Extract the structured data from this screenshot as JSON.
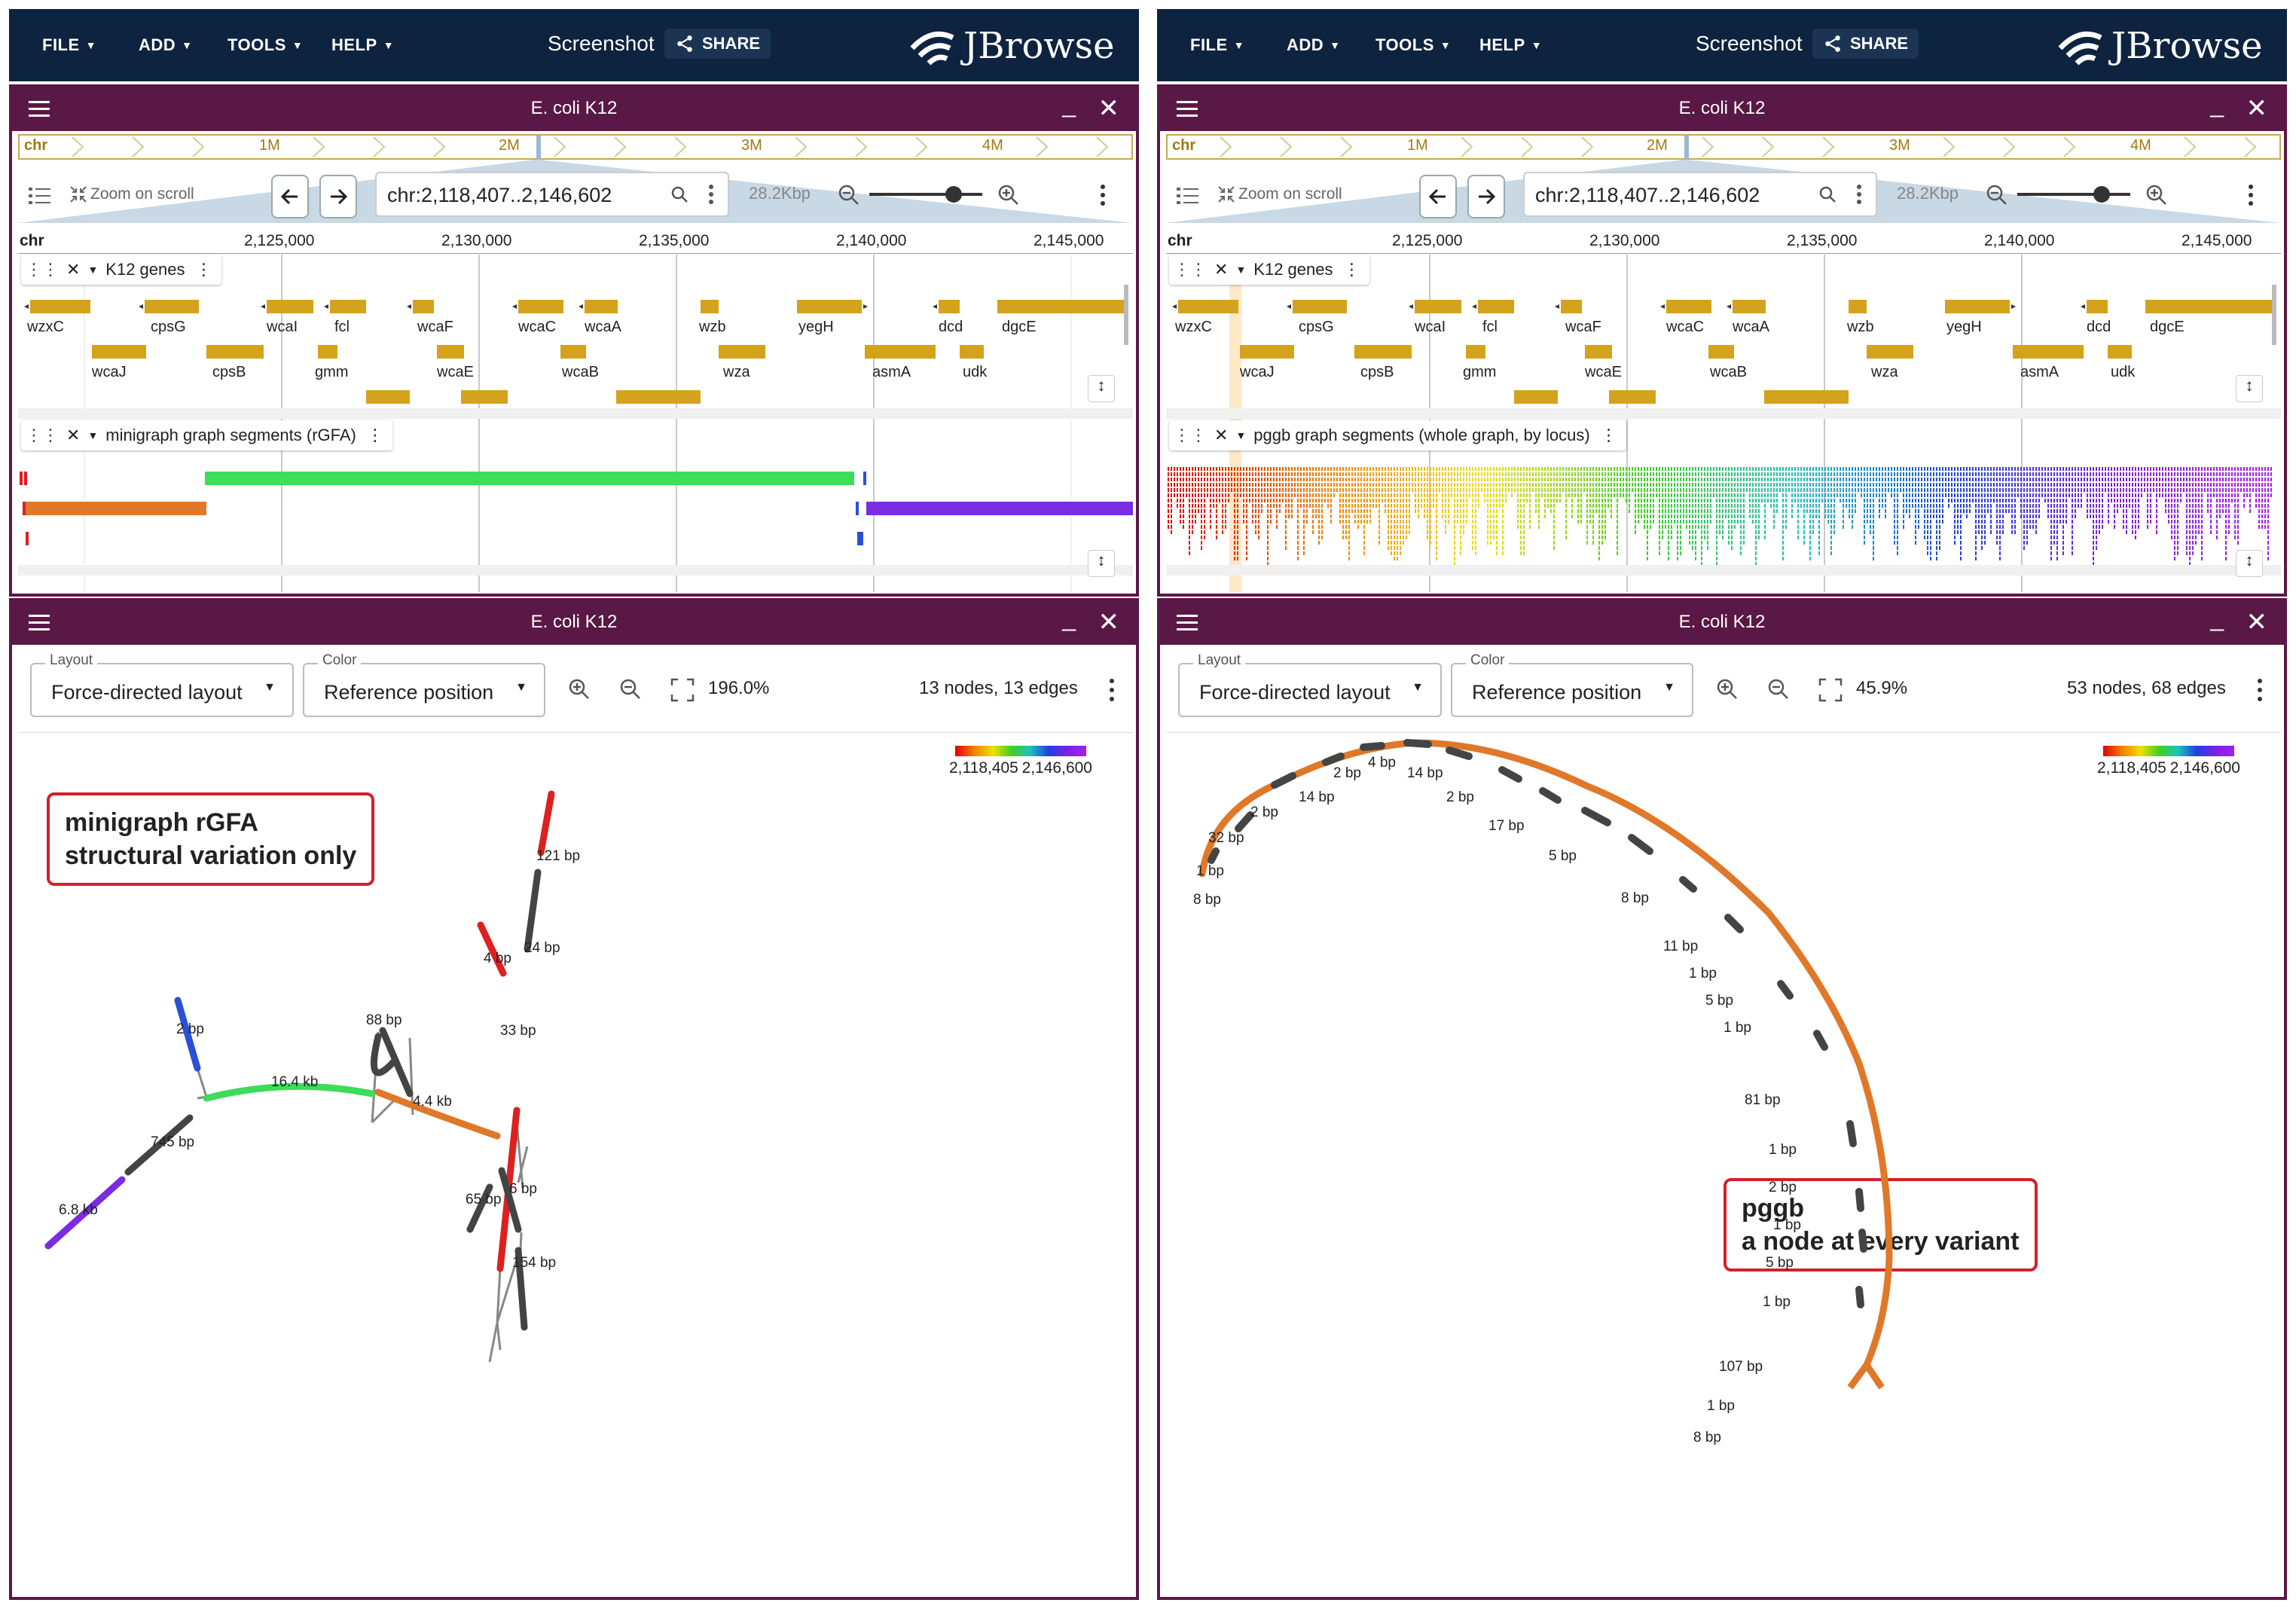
{
  "menu": {
    "file": "FILE",
    "add": "ADD",
    "tools": "TOOLS",
    "help": "HELP"
  },
  "screenshot_label": "Screenshot",
  "share_label": "SHARE",
  "logo_text": "JBrowse",
  "view_title": "E. coli K12",
  "ruler": {
    "chr": "chr",
    "m1": "1M",
    "m2": "2M",
    "m3": "3M",
    "m4": "4M"
  },
  "zoom_on_scroll": "Zoom on scroll",
  "locus": "chr:2,118,407..2,146,602",
  "bp_width": "28.2Kbp",
  "scale": {
    "chr": "chr",
    "ticks": [
      "2,125,000",
      "2,130,000",
      "2,135,000",
      "2,140,000",
      "2,145,000"
    ]
  },
  "gene_track_label": "K12 genes",
  "genes_row1": [
    "wzxC",
    "cpsG",
    "wcaI",
    "fcl",
    "wcaF",
    "wcaC",
    "wcaA",
    "wzb",
    "yegH",
    "dcd",
    "dgcE"
  ],
  "genes_row2": [
    "wcaJ",
    "cpsB",
    "gmm",
    "wcaE",
    "wcaB",
    "wza",
    "asmA",
    "udk"
  ],
  "left": {
    "segment_track_label": "minigraph graph segments (rGFA)",
    "layout_label": "Layout",
    "layout_value": "Force-directed layout",
    "color_label": "Color",
    "color_value": "Reference position",
    "zoom": "196.0%",
    "stats": "13 nodes, 13 edges",
    "legend_min": "2,118,405",
    "legend_max": "2,146,600",
    "callout_line1": "minigraph rGFA",
    "callout_line2": "structural variation only",
    "node_labels": [
      "121 bp",
      "24 bp",
      "4 bp",
      "2 bp",
      "88 bp",
      "33 bp",
      "16.4 kb",
      "4.4 kb",
      "745 bp",
      "6.8 kb",
      "65 bp",
      "6 bp",
      "154 bp"
    ]
  },
  "right": {
    "segment_track_label": "pggb graph segments (whole graph, by locus)",
    "layout_label": "Layout",
    "layout_value": "Force-directed layout",
    "color_label": "Color",
    "color_value": "Reference position",
    "zoom": "45.9%",
    "stats": "53 nodes, 68 edges",
    "legend_min": "2,118,405",
    "legend_max": "2,146,600",
    "callout_line1": "pggb",
    "callout_line2": "a node at every variant",
    "node_labels": [
      "14 bp",
      "2 bp",
      "4 bp",
      "2 bp",
      "14 bp",
      "2 bp",
      "32 bp",
      "17 bp",
      "1 bp",
      "5 bp",
      "8 bp",
      "8 bp",
      "11 bp",
      "1 bp",
      "5 bp",
      "1 bp",
      "81 bp",
      "1 bp",
      "2 bp",
      "1 bp",
      "5 bp",
      "1 bp",
      "107 bp",
      "1 bp",
      "8 bp"
    ]
  },
  "colors": {
    "topbar": "#0d233f",
    "view_header": "#5a1846",
    "gene": "#d4a21c",
    "segment_green": "#3ddc5a",
    "segment_orange": "#e0782a",
    "segment_purple": "#7a2ce0",
    "node_dark": "#444444",
    "node_red": "#dd2020",
    "node_blue": "#2a50d8"
  }
}
